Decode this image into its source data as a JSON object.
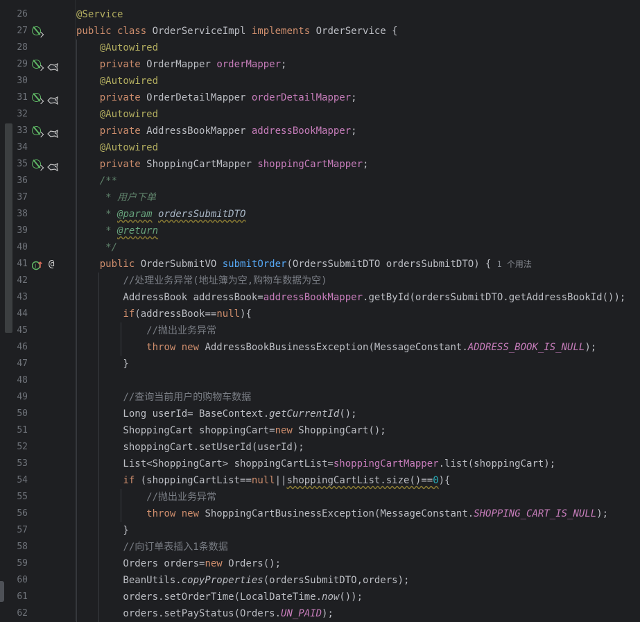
{
  "lines": [
    {
      "n": "26",
      "segs": [
        [
          "ann",
          "@Service"
        ]
      ]
    },
    {
      "n": "27",
      "segs": [
        [
          "kw",
          "public class "
        ],
        [
          "",
          "OrderServiceImpl "
        ],
        [
          "kw",
          "implements "
        ],
        [
          "",
          "OrderService {"
        ]
      ]
    },
    {
      "n": "28",
      "segs": [
        [
          "",
          "    "
        ],
        [
          "ann",
          "@Autowired"
        ]
      ]
    },
    {
      "n": "29",
      "segs": [
        [
          "",
          "    "
        ],
        [
          "kw",
          "private "
        ],
        [
          "",
          "OrderMapper "
        ],
        [
          "fld",
          "orderMapper"
        ],
        [
          "",
          ";"
        ]
      ]
    },
    {
      "n": "30",
      "segs": [
        [
          "",
          "    "
        ],
        [
          "ann",
          "@Autowired"
        ]
      ]
    },
    {
      "n": "31",
      "segs": [
        [
          "",
          "    "
        ],
        [
          "kw",
          "private "
        ],
        [
          "",
          "OrderDetailMapper "
        ],
        [
          "fld",
          "orderDetailMapper"
        ],
        [
          "",
          ";"
        ]
      ]
    },
    {
      "n": "32",
      "segs": [
        [
          "",
          "    "
        ],
        [
          "ann",
          "@Autowired"
        ]
      ]
    },
    {
      "n": "33",
      "segs": [
        [
          "",
          "    "
        ],
        [
          "kw",
          "private "
        ],
        [
          "",
          "AddressBookMapper "
        ],
        [
          "fld",
          "addressBookMapper"
        ],
        [
          "",
          ";"
        ]
      ]
    },
    {
      "n": "34",
      "segs": [
        [
          "",
          "    "
        ],
        [
          "ann",
          "@Autowired"
        ]
      ]
    },
    {
      "n": "35",
      "segs": [
        [
          "",
          "    "
        ],
        [
          "kw",
          "private "
        ],
        [
          "",
          "ShoppingCartMapper "
        ],
        [
          "fld",
          "shoppingCartMapper"
        ],
        [
          "",
          ";"
        ]
      ]
    },
    {
      "n": "36",
      "segs": [
        [
          "",
          "    "
        ],
        [
          "doc",
          "/**"
        ]
      ]
    },
    {
      "n": "37",
      "segs": [
        [
          "",
          "     "
        ],
        [
          "doc",
          "* 用户下单"
        ]
      ]
    },
    {
      "n": "38",
      "segs": [
        [
          "",
          "     "
        ],
        [
          "doc",
          "* "
        ],
        [
          "doctag",
          "@param"
        ],
        [
          "doc",
          " "
        ],
        [
          "docval",
          "ordersSubmitDTO"
        ]
      ]
    },
    {
      "n": "39",
      "segs": [
        [
          "",
          "     "
        ],
        [
          "doc",
          "* "
        ],
        [
          "doctag",
          "@return"
        ]
      ]
    },
    {
      "n": "40",
      "segs": [
        [
          "",
          "     "
        ],
        [
          "doc",
          "*/"
        ]
      ]
    },
    {
      "n": "41",
      "segs": [
        [
          "",
          "    "
        ],
        [
          "kw",
          "public "
        ],
        [
          "",
          "OrderSubmitVO "
        ],
        [
          "fn",
          "submitOrder"
        ],
        [
          "",
          "(OrdersSubmitDTO ordersSubmitDTO) {"
        ],
        [
          "hint",
          "1 个用法"
        ]
      ]
    },
    {
      "n": "42",
      "segs": [
        [
          "",
          "        "
        ],
        [
          "cmt",
          "//处理业务异常(地址簿为空,购物车数据为空)"
        ]
      ]
    },
    {
      "n": "43",
      "segs": [
        [
          "",
          "        AddressBook addressBook="
        ],
        [
          "fld",
          "addressBookMapper"
        ],
        [
          "",
          ".getById(ordersSubmitDTO.getAddressBookId());"
        ]
      ]
    },
    {
      "n": "44",
      "segs": [
        [
          "",
          "        "
        ],
        [
          "kw",
          "if"
        ],
        [
          "",
          "(addressBook=="
        ],
        [
          "kw",
          "null"
        ],
        [
          "",
          "){"
        ]
      ]
    },
    {
      "n": "45",
      "segs": [
        [
          "",
          "            "
        ],
        [
          "cmt",
          "//抛出业务异常"
        ]
      ]
    },
    {
      "n": "46",
      "segs": [
        [
          "",
          "            "
        ],
        [
          "kw",
          "throw new "
        ],
        [
          "",
          "AddressBookBusinessException(MessageConstant."
        ],
        [
          "const",
          "ADDRESS_BOOK_IS_NULL"
        ],
        [
          "",
          ");"
        ]
      ]
    },
    {
      "n": "47",
      "segs": [
        [
          "",
          "        }"
        ]
      ]
    },
    {
      "n": "48",
      "segs": []
    },
    {
      "n": "49",
      "segs": [
        [
          "",
          "        "
        ],
        [
          "cmt",
          "//查询当前用户的购物车数据"
        ]
      ]
    },
    {
      "n": "50",
      "segs": [
        [
          "",
          "        Long userId= BaseContext."
        ],
        [
          "ital",
          "getCurrentId"
        ],
        [
          "",
          "();"
        ]
      ]
    },
    {
      "n": "51",
      "segs": [
        [
          "",
          "        ShoppingCart shoppingCart="
        ],
        [
          "kw",
          "new "
        ],
        [
          "",
          "ShoppingCart();"
        ]
      ]
    },
    {
      "n": "52",
      "segs": [
        [
          "",
          "        shoppingCart.setUserId(userId);"
        ]
      ]
    },
    {
      "n": "53",
      "segs": [
        [
          "",
          "        List<ShoppingCart> shoppingCartList="
        ],
        [
          "fld",
          "shoppingCartMapper"
        ],
        [
          "",
          ".list(shoppingCart);"
        ]
      ]
    },
    {
      "n": "54",
      "segs": [
        [
          "",
          "        "
        ],
        [
          "kw",
          "if "
        ],
        [
          "",
          "(shoppingCartList=="
        ],
        [
          "kw",
          "null"
        ],
        [
          "",
          "||"
        ],
        [
          "warn",
          "shoppingCartList.size()=="
        ],
        [
          "num",
          "0"
        ],
        [
          "",
          "){"
        ]
      ]
    },
    {
      "n": "55",
      "segs": [
        [
          "",
          "            "
        ],
        [
          "cmt",
          "//抛出业务异常"
        ]
      ]
    },
    {
      "n": "56",
      "segs": [
        [
          "",
          "            "
        ],
        [
          "kw",
          "throw new "
        ],
        [
          "",
          "ShoppingCartBusinessException(MessageConstant."
        ],
        [
          "const",
          "SHOPPING_CART_IS_NULL"
        ],
        [
          "",
          ");"
        ]
      ]
    },
    {
      "n": "57",
      "segs": [
        [
          "",
          "        }"
        ]
      ]
    },
    {
      "n": "58",
      "segs": [
        [
          "",
          "        "
        ],
        [
          "cmt",
          "//向订单表插入1条数据"
        ]
      ]
    },
    {
      "n": "59",
      "segs": [
        [
          "",
          "        Orders orders="
        ],
        [
          "kw",
          "new "
        ],
        [
          "",
          "Orders();"
        ]
      ]
    },
    {
      "n": "60",
      "segs": [
        [
          "",
          "        BeanUtils."
        ],
        [
          "ital",
          "copyProperties"
        ],
        [
          "",
          "(ordersSubmitDTO,orders);"
        ]
      ]
    },
    {
      "n": "61",
      "segs": [
        [
          "",
          "        orders.setOrderTime(LocalDateTime."
        ],
        [
          "ital",
          "now"
        ],
        [
          "",
          "());"
        ]
      ]
    },
    {
      "n": "62",
      "segs": [
        [
          "",
          "        orders.setPayStatus(Orders."
        ],
        [
          "const",
          "UN_PAID"
        ],
        [
          "",
          ");"
        ]
      ]
    }
  ],
  "gutter_icons": {
    "27": [
      "bean-icon"
    ],
    "29": [
      "bean-icon",
      "mybatis-icon"
    ],
    "31": [
      "bean-icon",
      "mybatis-icon"
    ],
    "33": [
      "bean-icon",
      "mybatis-icon"
    ],
    "35": [
      "bean-icon",
      "mybatis-icon"
    ],
    "41": [
      "implementation-icon",
      "mention-icon"
    ]
  }
}
